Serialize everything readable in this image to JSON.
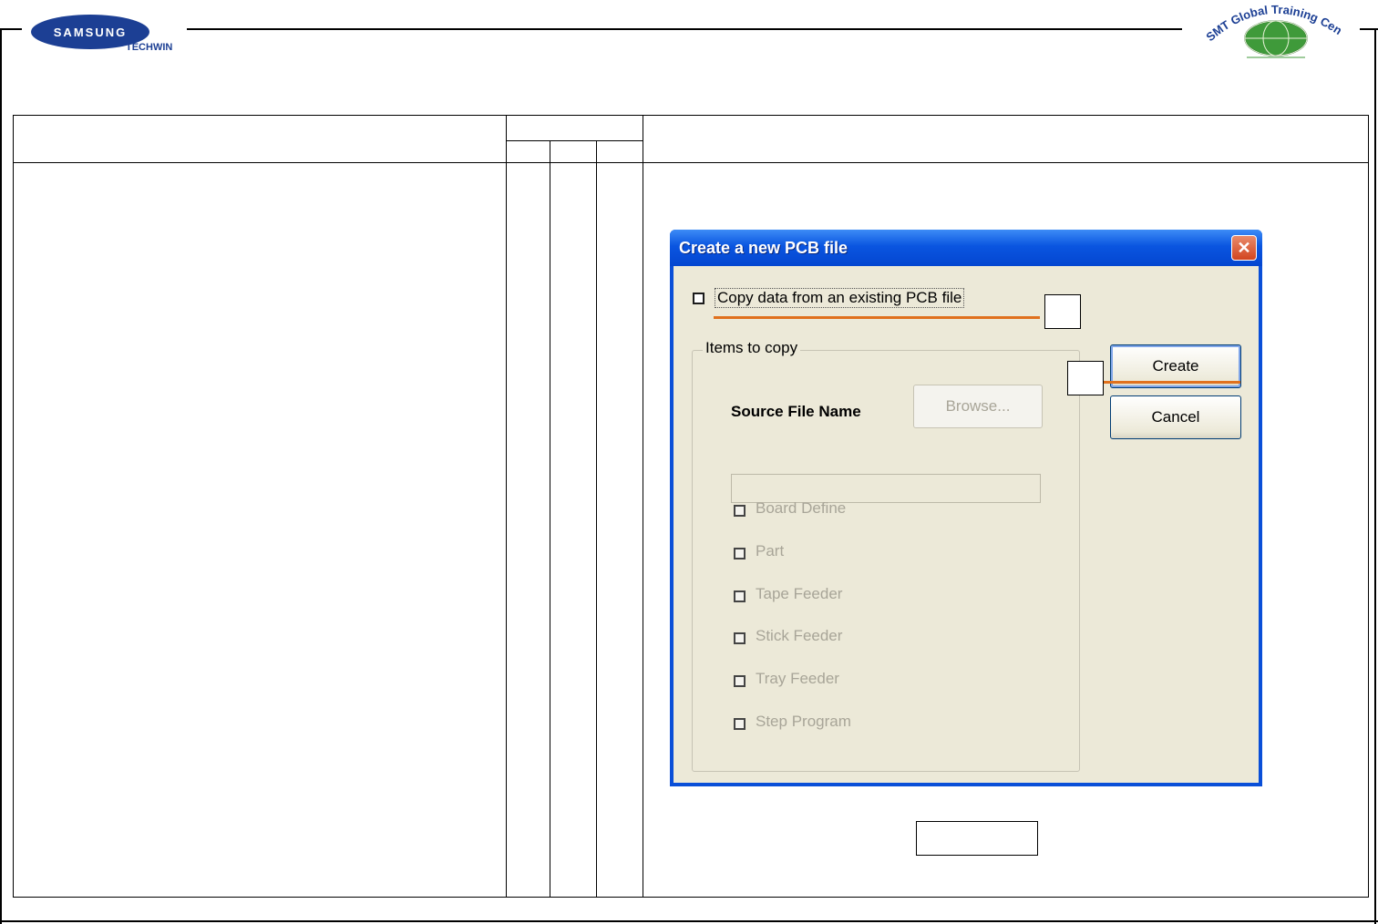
{
  "header": {
    "brand_top": "SAMSUNG",
    "brand_bottom": "TECHWIN",
    "training_center": "SMT Global Training Center"
  },
  "colors": {
    "samsung_blue": "#1c3f94",
    "xp_title_blue": "#0a55e0",
    "dialog_bg": "#ece9d8",
    "annotation_orange": "#e0711e"
  },
  "dialog": {
    "title": "Create a new PCB file",
    "close_icon": "close-icon",
    "copy_checkbox_label": "Copy data from an existing PCB file",
    "copy_checked": false,
    "group_title": "Items to copy",
    "source_file_label": "Source File Name",
    "source_file_value": "",
    "browse_label": "Browse...",
    "create_label": "Create",
    "cancel_label": "Cancel",
    "items": [
      {
        "label": "Board Define",
        "checked": false
      },
      {
        "label": "Part",
        "checked": false
      },
      {
        "label": "Tape Feeder",
        "checked": false
      },
      {
        "label": "Stick Feeder",
        "checked": false
      },
      {
        "label": "Tray Feeder",
        "checked": false
      },
      {
        "label": "Step Program",
        "checked": false
      }
    ]
  }
}
